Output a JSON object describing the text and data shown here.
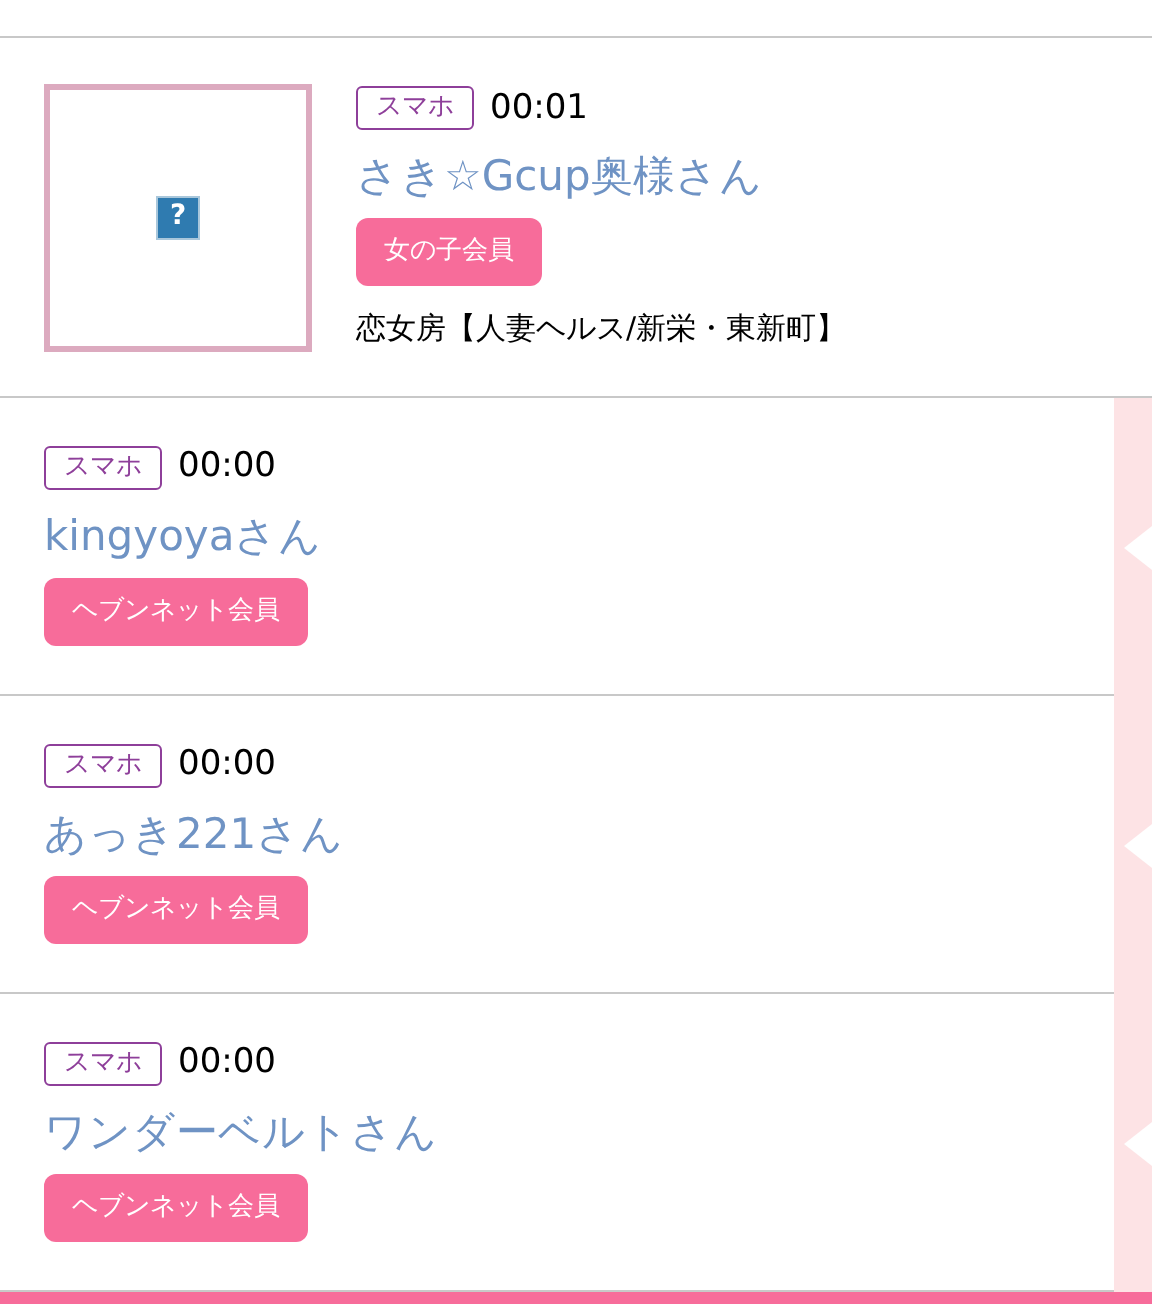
{
  "items": [
    {
      "kind": "photo",
      "image_icon": "?",
      "device": "スマホ",
      "time": "00:01",
      "name": "さき☆Gcup奥様さん",
      "member_type": "女の子会員",
      "shop": "恋女房【人妻ヘルス/新栄・東新町】"
    },
    {
      "kind": "plain",
      "device": "スマホ",
      "time": "00:00",
      "name": "kingyoyaさん",
      "member_type": "ヘブンネット会員"
    },
    {
      "kind": "plain",
      "device": "スマホ",
      "time": "00:00",
      "name": "あっき221さん",
      "member_type": "ヘブンネット会員"
    },
    {
      "kind": "plain",
      "device": "スマホ",
      "time": "00:00",
      "name": "ワンダーベルトさん",
      "member_type": "ヘブンネット会員"
    }
  ]
}
